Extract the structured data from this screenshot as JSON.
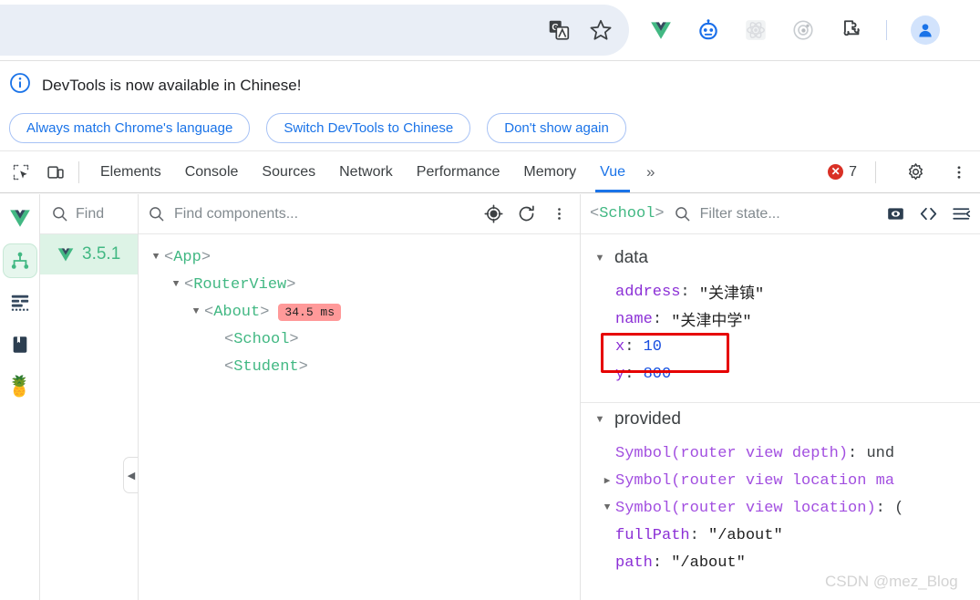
{
  "browser_toolbar": {
    "icons": [
      {
        "name": "translate-icon",
        "label": "Translate"
      },
      {
        "name": "bookmark-star-icon",
        "label": "Bookmark this tab"
      }
    ],
    "extensions": [
      {
        "name": "vue-devtools-extension-icon",
        "label": "Vue.js devtools"
      },
      {
        "name": "robot-extension-icon",
        "label": "Extension"
      },
      {
        "name": "react-devtools-extension-icon",
        "label": "React Developer Tools"
      },
      {
        "name": "atom-extension-icon",
        "label": "Extension"
      },
      {
        "name": "extensions-puzzle-icon",
        "label": "Extensions"
      }
    ],
    "avatar": {
      "name": "profile-avatar",
      "label": "Profile"
    }
  },
  "banner": {
    "message": "DevTools is now available in Chinese!",
    "buttons": [
      "Always match Chrome's language",
      "Switch DevTools to Chinese",
      "Don't show again"
    ]
  },
  "devtools_tabs": {
    "tools": [
      {
        "name": "inspect-element-icon",
        "label": "Inspect element"
      },
      {
        "name": "device-toolbar-icon",
        "label": "Toggle device toolbar"
      }
    ],
    "tabs": [
      {
        "label": "Elements",
        "active": false
      },
      {
        "label": "Console",
        "active": false
      },
      {
        "label": "Sources",
        "active": false
      },
      {
        "label": "Network",
        "active": false
      },
      {
        "label": "Performance",
        "active": false
      },
      {
        "label": "Memory",
        "active": false
      },
      {
        "label": "Vue",
        "active": true
      }
    ],
    "overflow_label": "»",
    "error_count": "7",
    "error_glyph": "✕",
    "settings_label": "Settings",
    "more_label": "More options",
    "accent_color": "#1a73e8",
    "error_color": "#d93025"
  },
  "vue_panel": {
    "rail": [
      {
        "name": "component-tree-icon",
        "label": "Components",
        "active": true
      },
      {
        "name": "timeline-icon",
        "label": "Timeline",
        "active": false
      },
      {
        "name": "book-icon",
        "label": "Documentation",
        "active": false
      },
      {
        "name": "pineapple-icon",
        "label": "Pinia",
        "active": false,
        "emoji": "🍍"
      }
    ],
    "mini_panel": {
      "search_placeholder": "Find",
      "app_version": "3.5.1",
      "collapse_glyph": "◀"
    },
    "tree": {
      "search_placeholder": "Find components...",
      "toolbar_icons": [
        {
          "name": "select-component-icon",
          "label": "Select component in page"
        },
        {
          "name": "refresh-icon",
          "label": "Refresh"
        },
        {
          "name": "tree-more-icon",
          "label": "More options"
        }
      ],
      "nodes": [
        {
          "name": "App",
          "depth": 0,
          "caret": "▼",
          "badge": ""
        },
        {
          "name": "RouterView",
          "depth": 1,
          "caret": "▼",
          "badge": ""
        },
        {
          "name": "About",
          "depth": 2,
          "caret": "▼",
          "badge": "34.5 ms"
        },
        {
          "name": "School",
          "depth": 3,
          "caret": "",
          "badge": ""
        },
        {
          "name": "Student",
          "depth": 3,
          "caret": "",
          "badge": ""
        }
      ]
    },
    "state": {
      "selected_component": "<School>",
      "filter_placeholder": "Filter state...",
      "toolbar_icons": [
        {
          "name": "inspect-dom-icon",
          "label": "Inspect DOM"
        },
        {
          "name": "open-in-editor-icon",
          "label": "Open in editor"
        },
        {
          "name": "collapse-all-icon",
          "label": "Collapse all"
        }
      ],
      "groups": [
        {
          "title": "data",
          "caret": "▼",
          "rows": [
            {
              "caret": "",
              "key": "address",
              "sep": ": ",
              "value": "\"关津镇\"",
              "value_type": "string"
            },
            {
              "caret": "",
              "key": "name",
              "sep": ": ",
              "value": "\"关津中学\"",
              "value_type": "string"
            },
            {
              "caret": "",
              "key": "x",
              "sep": ": ",
              "value": "10",
              "value_type": "number"
            },
            {
              "caret": "",
              "key": "y",
              "sep": ": ",
              "value": "800",
              "value_type": "number"
            }
          ]
        },
        {
          "title": "provided",
          "caret": "▼",
          "rows": [
            {
              "caret": "",
              "key": "Symbol(router view depth)",
              "sep": ": ",
              "value": "und",
              "value_type": "plain"
            },
            {
              "caret": "▶",
              "key": "Symbol(router view location ma",
              "sep": "",
              "value": "",
              "value_type": "plain"
            },
            {
              "caret": "▼",
              "key": "Symbol(router view location)",
              "sep": ": ",
              "value": "(",
              "value_type": "plain"
            },
            {
              "caret": "",
              "key": "fullPath",
              "sep": ": ",
              "value": "\"/about\"",
              "value_type": "string"
            },
            {
              "caret": "",
              "key": "path",
              "sep": ": ",
              "value": "\"/about\"",
              "value_type": "string"
            }
          ]
        }
      ]
    }
  },
  "annotation": {
    "highlight_color": "#e60000",
    "target_label": "x: 10"
  },
  "watermark": "CSDN @mez_Blog"
}
